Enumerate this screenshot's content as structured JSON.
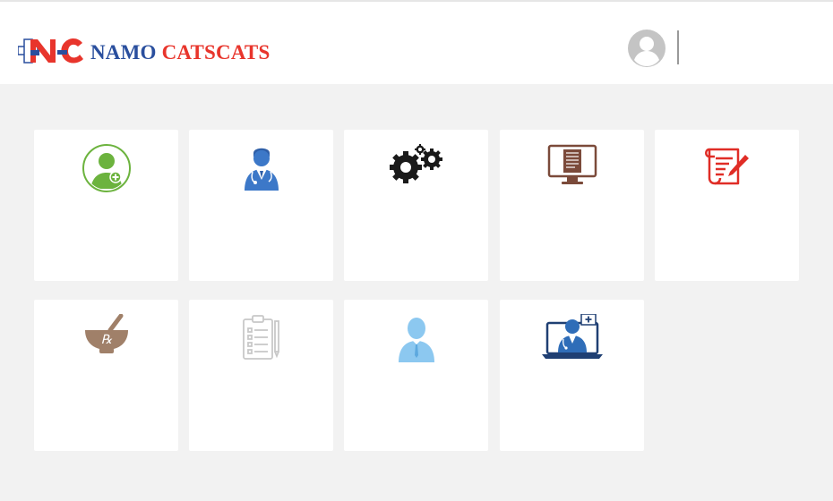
{
  "header": {
    "brand_word1": "NAMO",
    "brand_word2": "CATSCATS",
    "logo_mark": "NC",
    "user_icon": "user-circle-icon"
  },
  "tiles": [
    {
      "icon": "add-patient-icon",
      "label": "",
      "color": "#6cb33e"
    },
    {
      "icon": "doctor-icon",
      "label": "",
      "color": "#3c78c8"
    },
    {
      "icon": "gears-icon",
      "label": "",
      "color": "#1a1a1a"
    },
    {
      "icon": "monitor-report-icon",
      "label": "",
      "color": "#7b4a3a"
    },
    {
      "icon": "prescription-notepad-icon",
      "label": "",
      "color": "#e02d26"
    },
    {
      "icon": "mortar-pestle-rx-icon",
      "label": "",
      "color": "#a08069"
    },
    {
      "icon": "clipboard-checklist-icon",
      "label": "",
      "color": "#c8c8c8"
    },
    {
      "icon": "staff-person-icon",
      "label": "",
      "color": "#8cc8f0"
    },
    {
      "icon": "telemedicine-laptop-icon",
      "label": "",
      "color": "#2f6db8"
    }
  ],
  "colors": {
    "page_bg": "#f2f2f2",
    "header_bg": "#ffffff",
    "brand_blue": "#2a4f9e",
    "brand_red": "#e8352c"
  }
}
